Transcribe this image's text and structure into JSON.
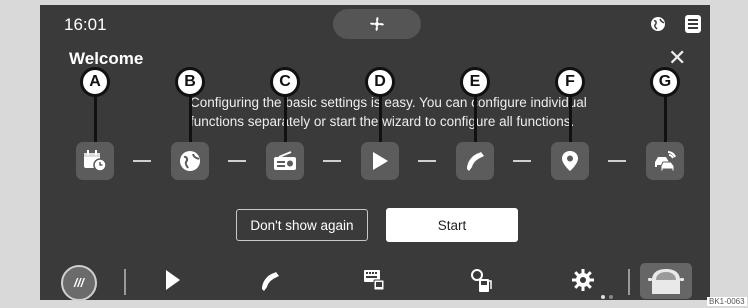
{
  "status_bar": {
    "time": "16:01",
    "fan_icon": "fan-icon",
    "globe_icon": "globe-icon",
    "list_icon": "list-icon"
  },
  "dialog": {
    "title": "Welcome",
    "close_icon": "close-icon",
    "description": "Configuring the basic settings is easy. You can configure individual functions separately or start the wizard to configure all functions.",
    "steps": [
      {
        "callout": "A",
        "icon": "calendar-clock-icon"
      },
      {
        "callout": "B",
        "icon": "globe-icon"
      },
      {
        "callout": "C",
        "icon": "radio-icon"
      },
      {
        "callout": "D",
        "icon": "play-icon"
      },
      {
        "callout": "E",
        "icon": "phone-icon"
      },
      {
        "callout": "F",
        "icon": "location-pin-icon"
      },
      {
        "callout": "G",
        "icon": "car-assist-icon"
      }
    ],
    "dont_show_again_label": "Don't show again",
    "start_label": "Start"
  },
  "dock": {
    "home_label": "///",
    "items": [
      "play-icon",
      "phone-icon",
      "keyboard-display-icon",
      "fuel-icon",
      "gear-icon",
      "car-icon"
    ]
  },
  "reference_code": "BK1-0063",
  "colors": {
    "screen": "#3a3a3a",
    "tile": "#5c5c5c",
    "frame": "#d9d9d9"
  }
}
